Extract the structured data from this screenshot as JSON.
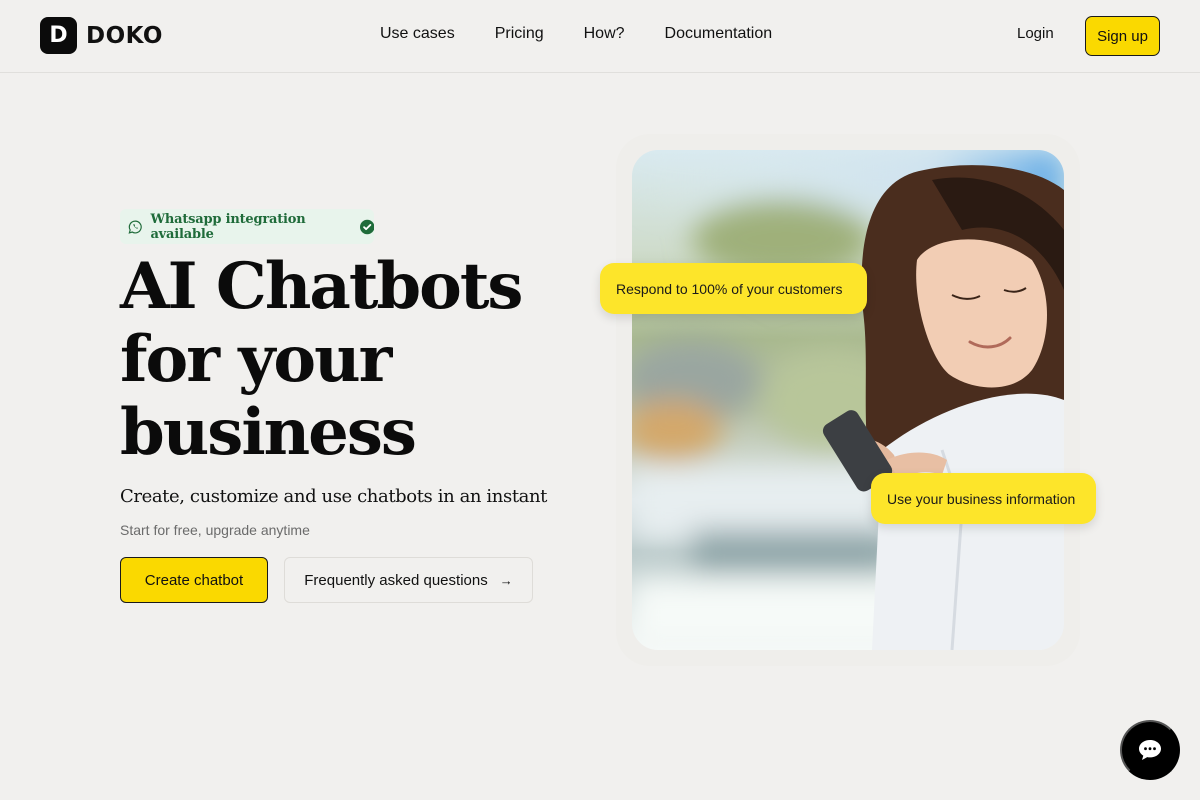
{
  "header": {
    "logo": {
      "mark": "D",
      "name": "DOKO"
    },
    "nav": [
      {
        "label": "Use cases"
      },
      {
        "label": "Pricing"
      },
      {
        "label": "How?"
      },
      {
        "label": "Documentation"
      }
    ],
    "login_label": "Login",
    "signup_label": "Sign up"
  },
  "hero": {
    "badge": {
      "icon": "whatsapp-icon",
      "text": "Whatsapp integration available",
      "status_icon": "check-circle-icon",
      "color": "#1f6b3a"
    },
    "headline": "AI Chatbots for your business",
    "subhead": "Create, customize and use chatbots in an instant",
    "subtext": "Start for free, upgrade anytime",
    "primary_button": "Create chatbot",
    "secondary_button": "Frequently asked questions",
    "secondary_button_icon": "→",
    "image": {
      "alt": "Woman smiling while using a smartphone",
      "bubbles": [
        {
          "text": "Respond to 100% of your customers"
        },
        {
          "text": "Use your business information"
        }
      ]
    }
  },
  "chat_widget": {
    "icon": "chat-bubble-icon"
  },
  "colors": {
    "accent": "#fad900",
    "bubble": "#fde52a",
    "background": "#f1f0ee",
    "text": "#111111"
  }
}
